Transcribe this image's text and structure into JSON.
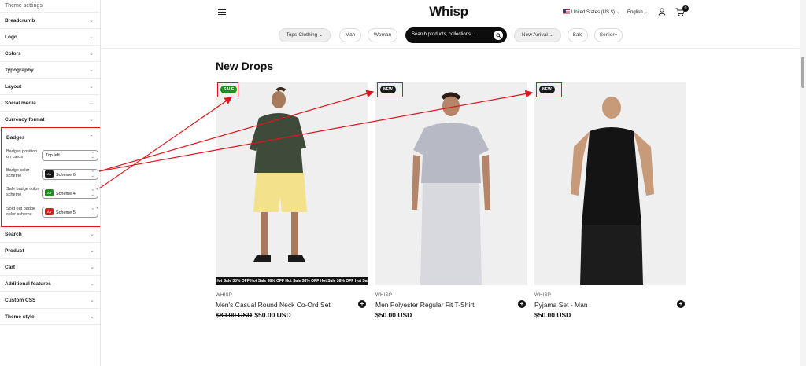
{
  "sidebar": {
    "title": "Theme settings",
    "sections_top": [
      "Breadcrumb",
      "Logo",
      "Colors",
      "Typography",
      "Layout",
      "Social media",
      "Currency format"
    ],
    "badges": {
      "label": "Badges",
      "position_label": "Badges position on cards",
      "position_value": "Top left",
      "color_label": "Badge color scheme",
      "color_value": "Scheme 6",
      "sale_label": "Sale badge color scheme",
      "sale_value": "Scheme 4",
      "soldout_label": "Sold out badge color scheme",
      "soldout_value": "Scheme 5",
      "swatch_text": "Aa",
      "colors": {
        "scheme6": "#1a1a1a",
        "scheme4": "#1e8f1e",
        "scheme5": "#d42020"
      }
    },
    "sections_bottom": [
      "Search",
      "Product",
      "Cart",
      "Additional features",
      "Custom CSS",
      "Theme style"
    ]
  },
  "header": {
    "logo": "Whisp",
    "locale": "United States (US $)",
    "language": "English",
    "cart_count": "0"
  },
  "nav": {
    "tops": "Tops-Clothing",
    "men": "Man",
    "women": "Woman",
    "search_placeholder": "Search products, collections...",
    "new_arrival": "New Arrival",
    "sale": "Sale",
    "senior": "Senior+"
  },
  "section": {
    "title": "New Drops"
  },
  "products": [
    {
      "badge": "SALE",
      "badge_color": "#1e8f1e",
      "vendor": "WHISP",
      "title": "Men's Casual Round Neck Co-Ord Set",
      "compare_price": "$80.00 USD",
      "price": "$50.00 USD",
      "ticker": "Hot Sale 38% OFF  Hot Sale 38% OFF  Hot Sale 38% OFF  Hot Sale 38% OFF  Hot Sale 38% OFF"
    },
    {
      "badge": "NEW",
      "badge_color": "#1a1a1a",
      "vendor": "WHISP",
      "title": "Men Polyester Regular Fit T-Shirt",
      "compare_price": "",
      "price": "$50.00 USD"
    },
    {
      "badge": "NEW",
      "badge_color": "#1a1a1a",
      "vendor": "WHISP",
      "title": "Pyjama Set - Man",
      "compare_price": "",
      "price": "$50.00 USD"
    }
  ],
  "annotation_color": "#e0141c"
}
